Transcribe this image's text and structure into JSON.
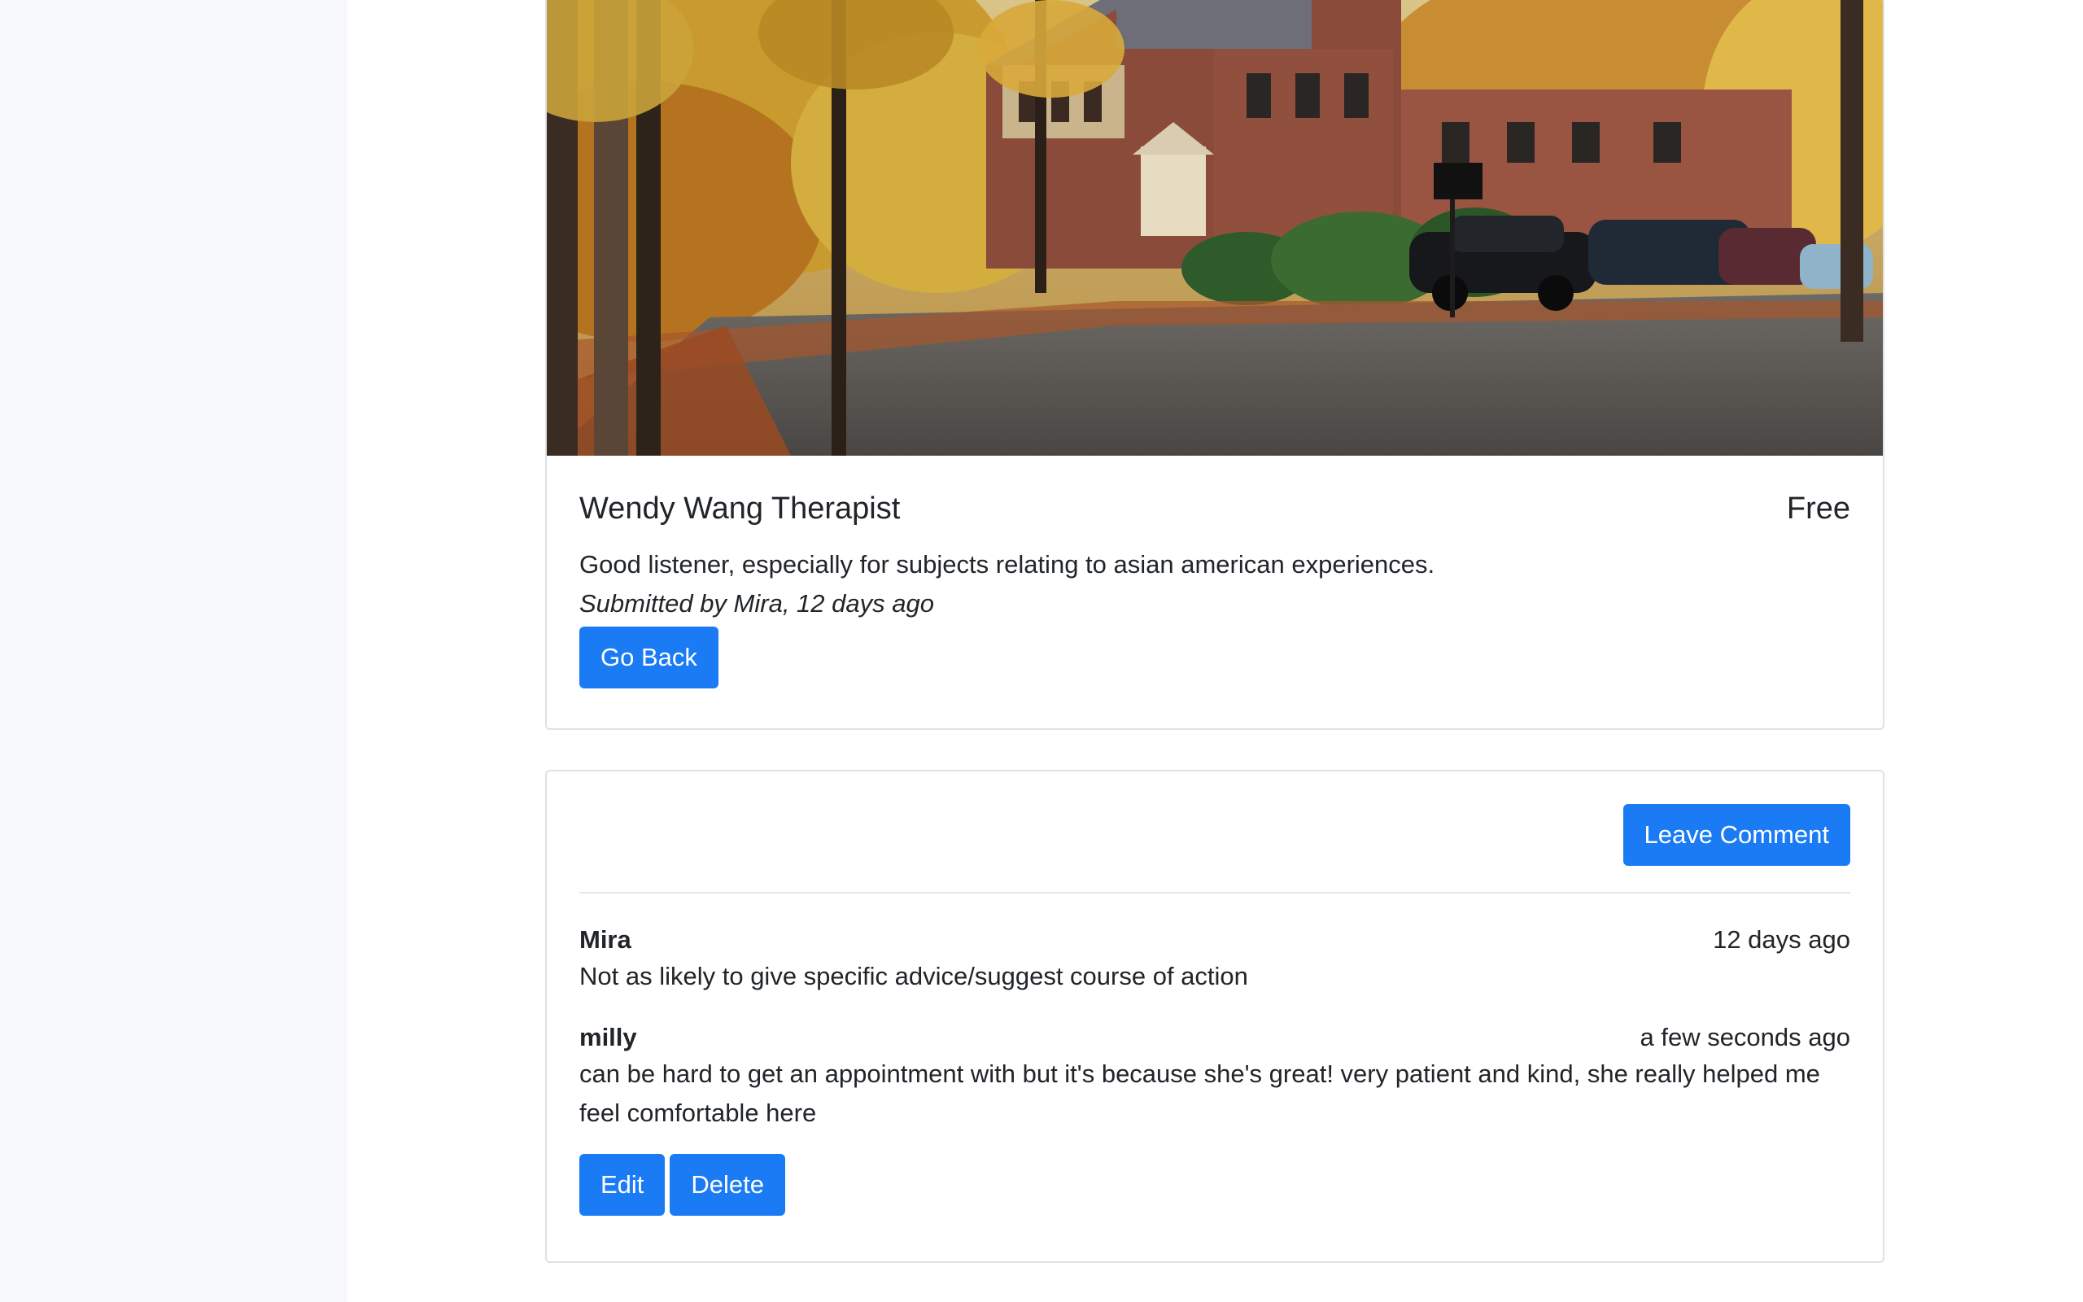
{
  "listing": {
    "name": "Wendy Wang Therapist",
    "price": "Free",
    "description": "Good listener, especially for subjects relating to asian american experiences.",
    "submitted": "Submitted by Mira, 12 days ago",
    "go_back_label": "Go Back",
    "photo_alt": "Autumn campus building with parked cars"
  },
  "comments_section": {
    "leave_comment_label": "Leave Comment",
    "comments": [
      {
        "author": "Mira",
        "time": "12 days ago",
        "text": "Not as likely to give specific advice/suggest course of action"
      },
      {
        "author": "milly",
        "time": "a few seconds ago",
        "text": "can be hard to get an appointment with but it's because she's great! very patient and kind, she really helped me feel comfortable here",
        "edit_label": "Edit",
        "delete_label": "Delete"
      }
    ]
  },
  "colors": {
    "primary_button": "#1a7bf5",
    "sidebar_background": "#f8f9fa",
    "card_border": "#dfe1e4"
  }
}
